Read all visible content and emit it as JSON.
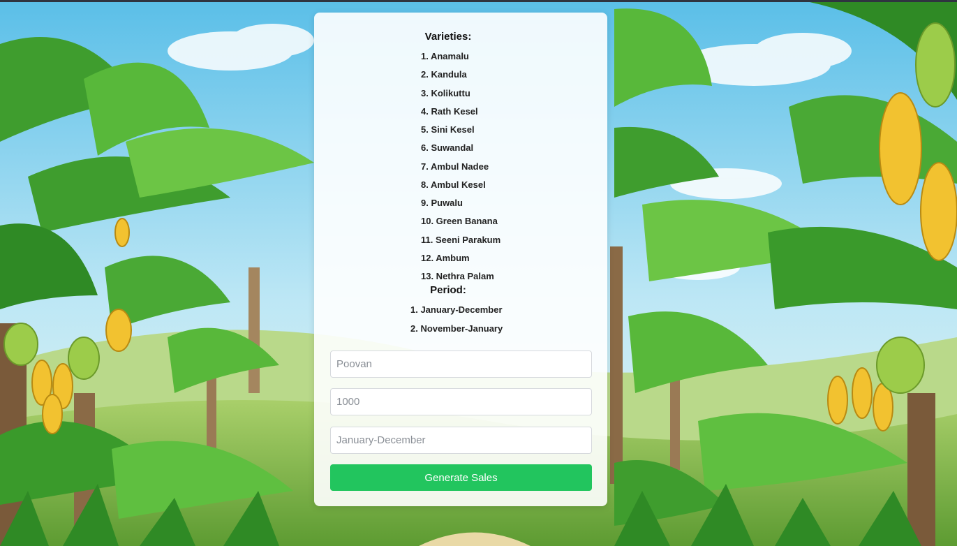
{
  "varieties": {
    "heading": "Varieties:",
    "items": [
      "1. Anamalu",
      "2. Kandula",
      "3. Kolikuttu",
      "4. Rath Kesel",
      "5. Sini Kesel",
      "6. Suwandal",
      "7. Ambul Nadee",
      "8. Ambul Kesel",
      "9. Puwalu",
      "10. Green Banana",
      "11. Seeni Parakum",
      "12. Ambum",
      "13. Nethra Palam"
    ]
  },
  "period": {
    "heading": "Period:",
    "items": [
      "1. January-December",
      "2. November-January"
    ]
  },
  "form": {
    "variety_placeholder": "Poovan",
    "quantity_placeholder": "1000",
    "period_placeholder": "January-December",
    "submit_label": "Generate Sales"
  },
  "colors": {
    "button": "#22c55e",
    "card": "#ffffff"
  }
}
